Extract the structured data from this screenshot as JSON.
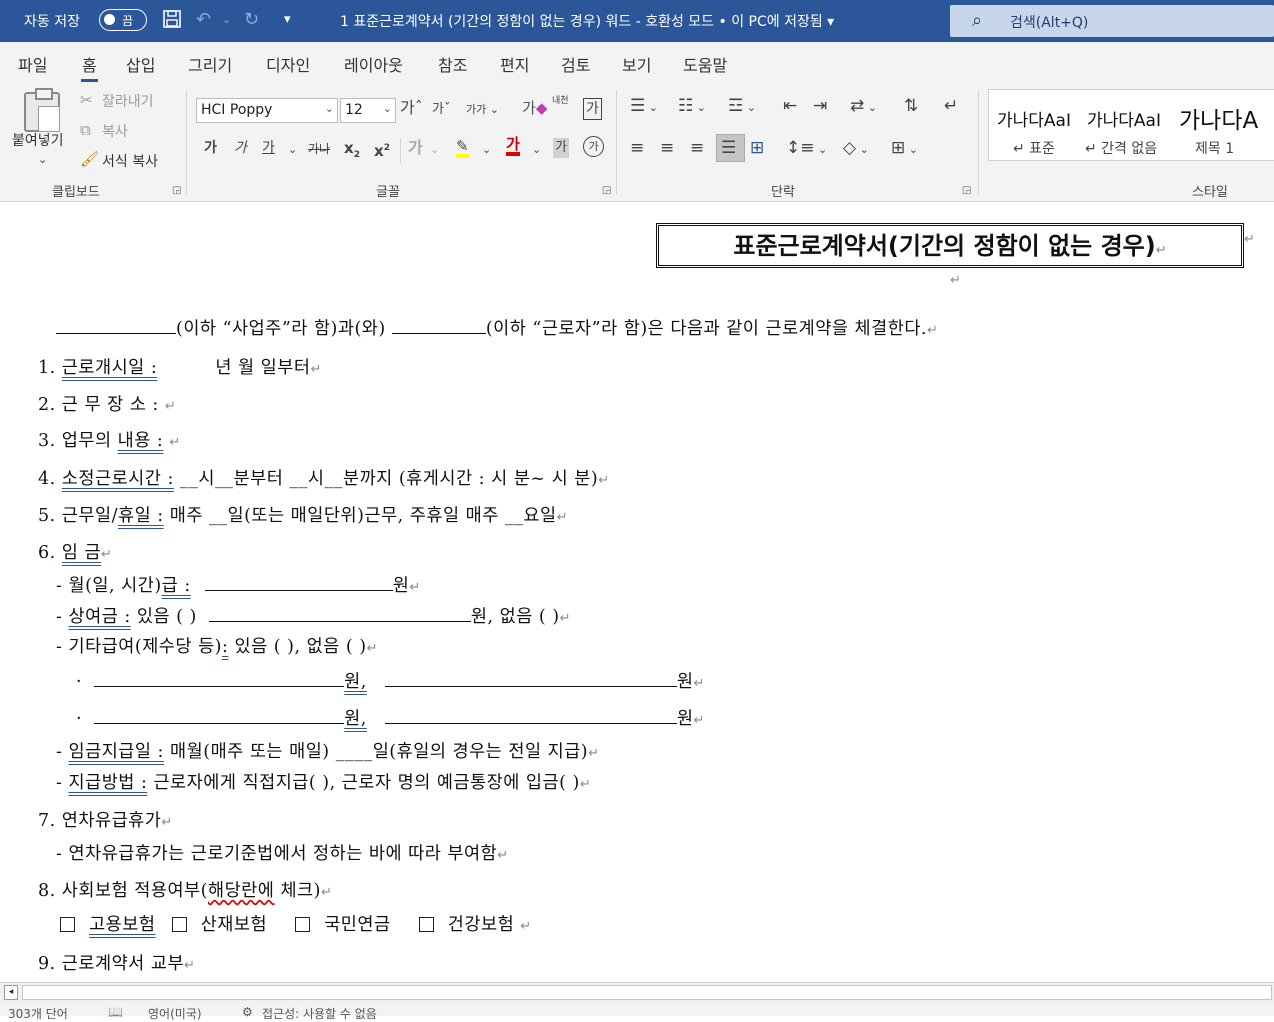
{
  "titlebar": {
    "autosave_label": "자동 저장",
    "autosave_state": "끔",
    "title": "1 표준근로계약서 (기간의 정함이 없는 경우) 워드  -  호환성 모드 • 이 PC에 저장됨  ▾",
    "search_placeholder": "검색(Alt+Q)",
    "accent_color": "#2b579a"
  },
  "tabs": [
    "파일",
    "홈",
    "삽입",
    "그리기",
    "디자인",
    "레이아웃",
    "참조",
    "편지",
    "검토",
    "보기",
    "도움말"
  ],
  "active_tab": "홈",
  "ribbon": {
    "clipboard": {
      "paste": "붙여넣기",
      "cut": "잘라내기",
      "copy": "복사",
      "format_painter": "서식 복사",
      "label": "클립보드"
    },
    "font": {
      "font_name": "HCI Poppy",
      "font_size": "12",
      "grow": "가",
      "shrink": "가",
      "case": "가가",
      "clear": "가",
      "phonetic": "내천",
      "charborder": "가",
      "bold": "가",
      "italic": "가",
      "underline": "가",
      "strike": "가나",
      "sub": "x",
      "sup": "x",
      "effects": "가",
      "highlight": "가",
      "fontcolor": "가",
      "shading": "가",
      "enclose": "가",
      "label": "글꼴"
    },
    "paragraph": {
      "label": "단락"
    },
    "styles": {
      "items": [
        {
          "preview": "가나다AaI",
          "name": "↵ 표준"
        },
        {
          "preview": "가나다AaI",
          "name": "↵ 간격 없음"
        },
        {
          "preview": "가나다A",
          "name": "제목 1"
        }
      ],
      "label": "스타일"
    }
  },
  "document": {
    "title": "표준근로계약서(기간의 정함이 없는 경우)",
    "intro_a": "(이하 “사업주”라 함)과(와)",
    "intro_b": "(이하 “근로자”라 함)은 다음과 같이 근로계약을 체결한다.",
    "item1_num": "1.",
    "item1_label": "근로개시일 :",
    "item1_rest": "년   월   일부터",
    "item2_num": "2.",
    "item2_label": "근 무 장 소 :",
    "item3_num": "3.",
    "item3_pre": "업무의",
    "item3_label": "내용 :",
    "item4_num": "4.",
    "item4_label": "소정근로시간 :",
    "item4_rest": "__시__분부터 __시__분까지 (휴게시간 :  시  분~  시   분)",
    "item5_num": "5.",
    "item5_pre": "근무일/",
    "item5_label": "휴일 :",
    "item5_rest": "매주 __일(또는 매일단위)근무, 주휴일 매주 __요일",
    "item6_num": "6.",
    "item6_label": "임    금",
    "wage1_pre": "-  월(일, 시간)",
    "wage1_label": "급 :",
    "wage1_unit": "원",
    "wage2_dash": "-",
    "wage2_label": "상여금 :",
    "wage2_yes": "있음  (       )",
    "wage2_rest": "원,   없음  (       )",
    "wage3_pre": "-  기타급여(제수당 등)",
    "wage3_label": ":",
    "wage3_rest": "있음  (       ),     없음  (       )",
    "wage_row_bullet": "·",
    "wage_row_unit1": "원,",
    "wage_row_unit2": "원",
    "payday_dash": "-",
    "payday_label": "임금지급일 :",
    "payday_rest": "매월(매주 또는 매일)    ____일(휴일의 경우는 전일 지급)",
    "paymethod_dash": "-",
    "paymethod_label": "지급방법 :",
    "paymethod_rest": "근로자에게 직접지급(      ),  근로자 명의 예금통장에 입금(      )",
    "item7_num": "7.",
    "item7_label": "연차유급휴가",
    "item7_sub": "-  연차유급휴가는 근로기준법에서 정하는 바에 따라 부여함",
    "item8_num": "8.",
    "item8_pre": "사회보험 적용여부(",
    "item8_wavy": "해당란에",
    "item8_post": " 체크)",
    "ins1": "고용보험",
    "ins2": "산재보험",
    "ins3": "국민연금",
    "ins4": "건강보험",
    "item9_num": "9.",
    "item9_label": "근로계약서 교부"
  },
  "statusbar": {
    "words": "303개 단어",
    "language": "영어(미국)",
    "accessibility": "접근성: 사용할 수 없음"
  }
}
